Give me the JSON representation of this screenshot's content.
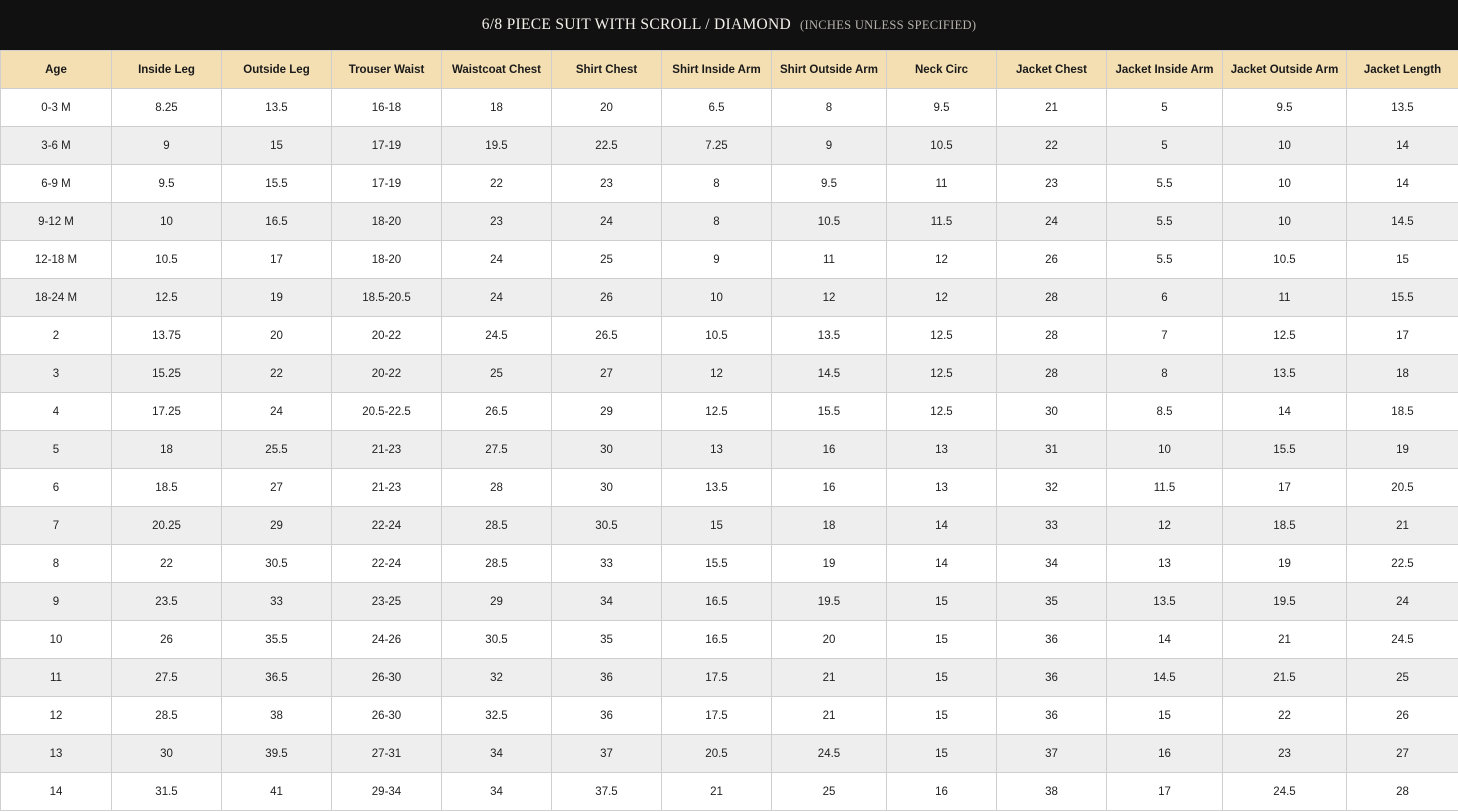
{
  "header": {
    "title": "6/8 PIECE SUIT WITH SCROLL / DIAMOND",
    "subtitle": "(INCHES UNLESS SPECIFIED)"
  },
  "colors": {
    "title_bar": "#111111",
    "header_row": "#f4dfb3",
    "row_alt": "#eeeeee"
  },
  "table": {
    "columns": [
      "Age",
      "Inside Leg",
      "Outside Leg",
      "Trouser Waist",
      "Waistcoat Chest",
      "Shirt Chest",
      "Shirt Inside Arm",
      "Shirt Outside Arm",
      "Neck Circ",
      "Jacket Chest",
      "Jacket Inside Arm",
      "Jacket Outside Arm",
      "Jacket Length"
    ],
    "rows": [
      [
        "0-3 M",
        "8.25",
        "13.5",
        "16-18",
        "18",
        "20",
        "6.5",
        "8",
        "9.5",
        "21",
        "5",
        "9.5",
        "13.5"
      ],
      [
        "3-6 M",
        "9",
        "15",
        "17-19",
        "19.5",
        "22.5",
        "7.25",
        "9",
        "10.5",
        "22",
        "5",
        "10",
        "14"
      ],
      [
        "6-9 M",
        "9.5",
        "15.5",
        "17-19",
        "22",
        "23",
        "8",
        "9.5",
        "11",
        "23",
        "5.5",
        "10",
        "14"
      ],
      [
        "9-12 M",
        "10",
        "16.5",
        "18-20",
        "23",
        "24",
        "8",
        "10.5",
        "11.5",
        "24",
        "5.5",
        "10",
        "14.5"
      ],
      [
        "12-18 M",
        "10.5",
        "17",
        "18-20",
        "24",
        "25",
        "9",
        "11",
        "12",
        "26",
        "5.5",
        "10.5",
        "15"
      ],
      [
        "18-24 M",
        "12.5",
        "19",
        "18.5-20.5",
        "24",
        "26",
        "10",
        "12",
        "12",
        "28",
        "6",
        "11",
        "15.5"
      ],
      [
        "2",
        "13.75",
        "20",
        "20-22",
        "24.5",
        "26.5",
        "10.5",
        "13.5",
        "12.5",
        "28",
        "7",
        "12.5",
        "17"
      ],
      [
        "3",
        "15.25",
        "22",
        "20-22",
        "25",
        "27",
        "12",
        "14.5",
        "12.5",
        "28",
        "8",
        "13.5",
        "18"
      ],
      [
        "4",
        "17.25",
        "24",
        "20.5-22.5",
        "26.5",
        "29",
        "12.5",
        "15.5",
        "12.5",
        "30",
        "8.5",
        "14",
        "18.5"
      ],
      [
        "5",
        "18",
        "25.5",
        "21-23",
        "27.5",
        "30",
        "13",
        "16",
        "13",
        "31",
        "10",
        "15.5",
        "19"
      ],
      [
        "6",
        "18.5",
        "27",
        "21-23",
        "28",
        "30",
        "13.5",
        "16",
        "13",
        "32",
        "11.5",
        "17",
        "20.5"
      ],
      [
        "7",
        "20.25",
        "29",
        "22-24",
        "28.5",
        "30.5",
        "15",
        "18",
        "14",
        "33",
        "12",
        "18.5",
        "21"
      ],
      [
        "8",
        "22",
        "30.5",
        "22-24",
        "28.5",
        "33",
        "15.5",
        "19",
        "14",
        "34",
        "13",
        "19",
        "22.5"
      ],
      [
        "9",
        "23.5",
        "33",
        "23-25",
        "29",
        "34",
        "16.5",
        "19.5",
        "15",
        "35",
        "13.5",
        "19.5",
        "24"
      ],
      [
        "10",
        "26",
        "35.5",
        "24-26",
        "30.5",
        "35",
        "16.5",
        "20",
        "15",
        "36",
        "14",
        "21",
        "24.5"
      ],
      [
        "11",
        "27.5",
        "36.5",
        "26-30",
        "32",
        "36",
        "17.5",
        "21",
        "15",
        "36",
        "14.5",
        "21.5",
        "25"
      ],
      [
        "12",
        "28.5",
        "38",
        "26-30",
        "32.5",
        "36",
        "17.5",
        "21",
        "15",
        "36",
        "15",
        "22",
        "26"
      ],
      [
        "13",
        "30",
        "39.5",
        "27-31",
        "34",
        "37",
        "20.5",
        "24.5",
        "15",
        "37",
        "16",
        "23",
        "27"
      ],
      [
        "14",
        "31.5",
        "41",
        "29-34",
        "34",
        "37.5",
        "21",
        "25",
        "16",
        "38",
        "17",
        "24.5",
        "28"
      ]
    ]
  }
}
